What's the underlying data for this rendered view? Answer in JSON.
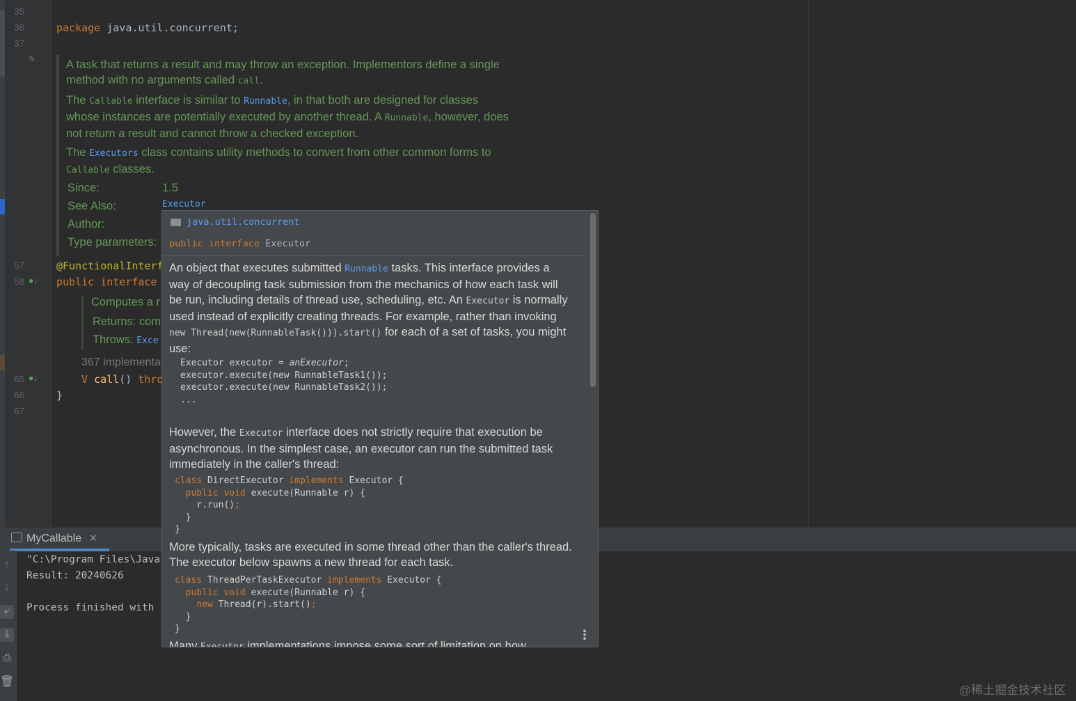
{
  "editor": {
    "line_numbers": [
      "35",
      "36",
      "37",
      "57",
      "58",
      "65",
      "66",
      "67"
    ],
    "code": {
      "line36_kw": "package",
      "line36_rest": " java.util.concurrent;",
      "line57_ann": "@FunctionalInterf",
      "line58_kw": "public interface",
      "line65_type": "V",
      "line65_method": "call",
      "line65_parens": "()",
      "line65_throws": "thro",
      "line66_brace": "}"
    },
    "javadoc": {
      "p1_text1": "A task that returns a result and may throw an exception. Implementors define a single method with no arguments called ",
      "p1_code": "call",
      "p1_text2": ".",
      "p2_text1": "The ",
      "p2_code1": "Callable",
      "p2_text2": " interface is similar to ",
      "p2_link1": "Runnable",
      "p2_text3": ", in that both are designed for classes whose instances are potentially executed by another thread. A ",
      "p2_code2": "Runnable",
      "p2_text4": ", however, does not return a result and cannot throw a checked exception.",
      "p3_text1": "The ",
      "p3_link1": "Executors",
      "p3_text2": " class contains utility methods to convert from other common forms to ",
      "p3_code1": "Callable",
      "p3_text3": " classes.",
      "since_label": "Since:",
      "since_value": "1.5",
      "see_also_label": "See Also:",
      "see_also_value": "Executor",
      "author_label": "Author:",
      "type_params_label": "Type parameters:"
    },
    "call_doc": {
      "computes": "Computes a r",
      "returns": "Returns: com",
      "throws_label": "Throws: ",
      "throws_link": "Exce"
    },
    "implementations": "367 implementa"
  },
  "popup": {
    "package": "java.util.concurrent",
    "sig_kw": "public interface",
    "sig_name": " Executor",
    "p1_a": "An object that executes submitted ",
    "p1_link": "Runnable",
    "p1_b": " tasks. This interface provides a way of decoupling task submission from the mechanics of how each task will be run, including details of thread use, scheduling, etc. An ",
    "p1_code1": "Executor",
    "p1_c": " is normally used instead of explicitly creating threads. For example, rather than invoking ",
    "p1_code2": "new Thread(new(RunnableTask())).start()",
    "p1_d": " for each of a set of tasks, you might use:",
    "code1_l1a": "Executor executor = ",
    "code1_l1b": "anExecutor",
    "code1_l1c": ";",
    "code1_l2": "executor.execute(new RunnableTask1());",
    "code1_l3": "executor.execute(new RunnableTask2());",
    "code1_l4": "...",
    "p2_a": "However, the ",
    "p2_code": "Executor",
    "p2_b": " interface does not strictly require that execution be asynchronous. In the simplest case, an executor can run the submitted task immediately in the caller's thread:",
    "code2": {
      "kw_class": "class",
      "name": " DirectExecutor ",
      "kw_impl": "implements",
      "iface": " Executor {",
      "kw_pv": "public void",
      "m": " execute(Runnable r) {",
      "body": "r.run()",
      "semi": ";",
      "close_inner": "}",
      "close_outer": "}"
    },
    "p3": "More typically, tasks are executed in some thread other than the caller's thread. The executor below spawns a new thread for each task.",
    "code3": {
      "kw_class": "class",
      "name": " ThreadPerTaskExecutor ",
      "kw_impl": "implements",
      "iface": " Executor {",
      "kw_pv": "public void",
      "m": " execute(Runnable r) {",
      "kw_new": "new",
      "body": " Thread(r).start()",
      "semi": ";",
      "close_inner": "}",
      "close_outer": "}"
    },
    "p4_a": "Many ",
    "p4_code": "Executor",
    "p4_b": " implementations impose some sort of limitation on how"
  },
  "run_panel": {
    "tab_label": "MyCallable",
    "output": [
      "\"C:\\Program Files\\Java",
      "Result: 20240626",
      "",
      "Process finished with"
    ]
  },
  "watermark": "@稀土掘金技术社区"
}
